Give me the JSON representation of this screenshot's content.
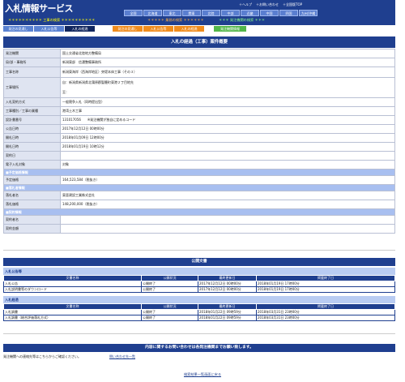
{
  "header": {
    "logo": "入札情報サービス",
    "topnav": [
      "＋ヘルプ",
      "＋お問い合わせ",
      "＋全国版TOP"
    ],
    "regions": [
      "全国",
      "北海道",
      "東北",
      "関東",
      "北陸",
      "中部",
      "近畿",
      "中国",
      "四国",
      "九州/沖縄"
    ],
    "menu_construction": "＊＊＊＊＊＊＊＊＊＊ 工事の検索 ＊＊＊＊＊＊＊＊＊＊",
    "menu_service": "＊＊＊＊＊ 業務の検索 ＊＊＊＊＊＊",
    "menu_agency": "＊＊＊ 発注機関の検索 ＊＊＊"
  },
  "tabs": [
    {
      "label": "発注の見通し",
      "style": "blue"
    },
    {
      "label": "入札公告等",
      "style": "blue"
    },
    {
      "label": "入札の経過",
      "style": "active"
    },
    {
      "label": "発注の見通し",
      "style": "orange"
    },
    {
      "label": "入札公告等",
      "style": "orange"
    },
    {
      "label": "入札の経過",
      "style": "orange"
    },
    {
      "label": "発注機関情報",
      "style": "green"
    }
  ],
  "title": "入札の経過（工事）案件概要",
  "rows": [
    {
      "label": "発注機関",
      "value": "国土交通省北陸地方整備局"
    },
    {
      "label": "局/部・事務所",
      "value": "新潟東部　信濃整備事務所"
    },
    {
      "label": "工事名称",
      "value": "新潟東海岸（西海岸地区）突堤本体工事（その３）"
    },
    {
      "label": "工事場所",
      "value": "自：新潟県新潟県北蒲原郡聖籠町東港２丁目地先",
      "value2": "至："
    },
    {
      "label": "入札契約方式",
      "value": "一般競争入札（同時提出型）"
    },
    {
      "label": "工事種別／工事の業種",
      "value": "港湾土木工事"
    },
    {
      "label": "設計書番号",
      "value": "131017056　　※発注機関が独自に定めるコード"
    },
    {
      "label": "公告日時",
      "value": "2017年12月12日 00時00分"
    },
    {
      "label": "開札日時",
      "value": "2018年01月09日 12時00分"
    },
    {
      "label": "開札日時",
      "value": "2018年01月19日 10時12分"
    },
    {
      "label": "契約日",
      "value": ""
    },
    {
      "label": "電子入札対象",
      "value": "対象"
    }
  ],
  "sec_estimate": "■予定価格情報",
  "estimate_label": "予定価格",
  "estimate_value": "164,523,584（税抜き）",
  "sec_winner": "■落札者情報",
  "winner_name_label": "落札者名",
  "winner_name_value": "東亜建設工業株式会社",
  "winner_price_label": "落札価格",
  "winner_price_value": "148,200,000（税抜き）",
  "sec_contract": "■契約情報",
  "contract_party_label": "契約者名",
  "contract_party_value": "",
  "contract_amount_label": "契約金額",
  "contract_amount_value": "",
  "pub_title": "公開文書",
  "block1": {
    "title": "入札公告等",
    "headers": [
      "文書名称",
      "公開状況",
      "最終更新日",
      "掲載終了日"
    ],
    "rows": [
      [
        "入札公告",
        "公開終了",
        "2017年12月12日 00時00分",
        "2018年01月19日 17時00分"
      ],
      [
        "入札説明書等のダウンロード",
        "公開終了",
        "2017年12月12日 00時00分",
        "2018年01月19日 17時00分"
      ]
    ]
  },
  "block2": {
    "title": "入札経過",
    "headers": [
      "文書名称",
      "公開状況",
      "最終更新日",
      "掲載終了日"
    ],
    "rows": [
      [
        "入札調書",
        "公開終了",
        "2018年01月22日 09時59分",
        "2018年03月31日 23時00分"
      ],
      [
        "入札調書（総合評価落札方式）",
        "公開終了",
        "2018年01月22日 09時59分",
        "2018年03月31日 23時00分"
      ]
    ]
  },
  "contact_title": "内容に関するお問い合わせは各発注機関までお願い致します。",
  "contact_text": "発注機関への連絡先等はこちらからご確認ください。",
  "contact_link": "問い合わせ先一覧",
  "back_link": "検索結果一覧画面に戻る"
}
